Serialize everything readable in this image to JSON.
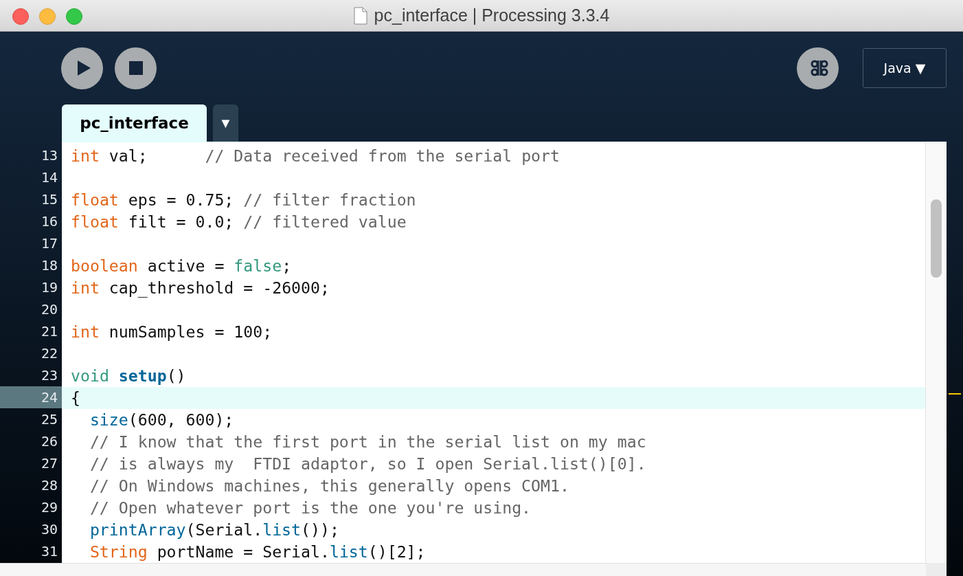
{
  "window": {
    "title": "pc_interface | Processing 3.3.4"
  },
  "toolbar": {
    "mode": "Java ▼"
  },
  "tabs": [
    {
      "label": "pc_interface",
      "selected": true
    }
  ],
  "tab_menu": "▼",
  "editor": {
    "lines": [
      {
        "number": "13",
        "current": false,
        "indented": false,
        "tokens": [
          {
            "kind": "keyword",
            "text": "int"
          },
          {
            "kind": "plain",
            "text": " val;      "
          },
          {
            "kind": "comment",
            "text": "// Data received from the serial port"
          }
        ]
      },
      {
        "number": "14",
        "current": false
      },
      {
        "number": "15",
        "current": false,
        "indented": false,
        "tokens": [
          {
            "kind": "keyword",
            "text": "float"
          },
          {
            "kind": "plain",
            "text": " eps = 0.75; "
          },
          {
            "kind": "comment",
            "text": "// filter fraction"
          }
        ]
      },
      {
        "number": "16",
        "current": false,
        "indented": false,
        "tokens": [
          {
            "kind": "keyword",
            "text": "float"
          },
          {
            "kind": "plain",
            "text": " filt = 0.0; "
          },
          {
            "kind": "comment",
            "text": "// filtered value"
          }
        ]
      },
      {
        "number": "17",
        "current": false
      },
      {
        "number": "18",
        "current": false,
        "indented": false,
        "tokens": [
          {
            "kind": "keyword",
            "text": "boolean"
          },
          {
            "kind": "plain",
            "text": " active = "
          },
          {
            "kind": "literal",
            "text": "false"
          },
          {
            "kind": "plain",
            "text": ";"
          }
        ]
      },
      {
        "number": "19",
        "current": false,
        "indented": false,
        "tokens": [
          {
            "kind": "keyword",
            "text": "int"
          },
          {
            "kind": "plain",
            "text": " cap_threshold = -26000;"
          }
        ]
      },
      {
        "number": "20",
        "current": false
      },
      {
        "number": "21",
        "current": false,
        "indented": false,
        "tokens": [
          {
            "kind": "keyword",
            "text": "int"
          },
          {
            "kind": "plain",
            "text": " numSamples = 100;"
          }
        ]
      },
      {
        "number": "22",
        "current": false
      },
      {
        "number": "23",
        "current": false,
        "indented": false,
        "tokens": [
          {
            "kind": "literal",
            "text": "void "
          },
          {
            "kind": "definition",
            "text": "setup"
          },
          {
            "kind": "plain",
            "text": "()"
          }
        ]
      },
      {
        "number": "24",
        "current": true,
        "indented": false,
        "tokens": [
          {
            "kind": "plain",
            "text": "{"
          }
        ]
      },
      {
        "number": "25",
        "current": false,
        "indented": true,
        "tokens": [
          {
            "kind": "function",
            "text": "size"
          },
          {
            "kind": "plain",
            "text": "(600, 600);"
          }
        ]
      },
      {
        "number": "26",
        "current": false,
        "indented": true,
        "tokens": [
          {
            "kind": "comment",
            "text": "// I know that the first port in the serial list on my mac"
          }
        ]
      },
      {
        "number": "27",
        "current": false,
        "indented": true,
        "tokens": [
          {
            "kind": "comment",
            "text": "// is always my  FTDI adaptor, so I open Serial.list()[0]."
          }
        ]
      },
      {
        "number": "28",
        "current": false,
        "indented": true,
        "tokens": [
          {
            "kind": "comment",
            "text": "// On Windows machines, this generally opens COM1."
          }
        ]
      },
      {
        "number": "29",
        "current": false,
        "indented": true,
        "tokens": [
          {
            "kind": "comment",
            "text": "// Open whatever port is the one you're using."
          }
        ]
      },
      {
        "number": "30",
        "current": false,
        "indented": true,
        "tokens": [
          {
            "kind": "function",
            "text": "printArray"
          },
          {
            "kind": "plain",
            "text": "(Serial."
          },
          {
            "kind": "function",
            "text": "list"
          },
          {
            "kind": "plain",
            "text": "());"
          }
        ]
      },
      {
        "number": "31",
        "current": false,
        "indented": true,
        "tokens": [
          {
            "kind": "keyword",
            "text": "String"
          },
          {
            "kind": "plain",
            "text": " portName = Serial."
          },
          {
            "kind": "function",
            "text": "list"
          },
          {
            "kind": "plain",
            "text": "()[2];"
          }
        ]
      }
    ]
  }
}
